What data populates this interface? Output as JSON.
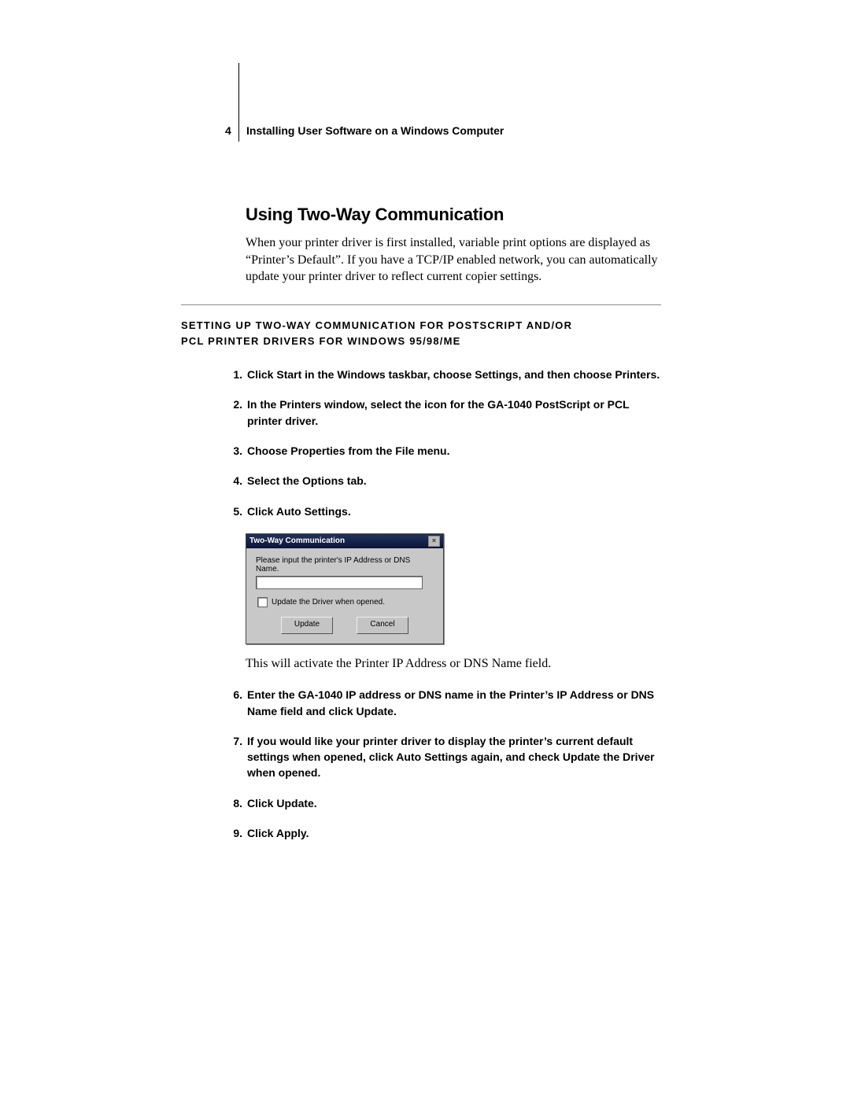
{
  "header": {
    "page_number": "4",
    "running_head": "Installing User Software on a Windows Computer"
  },
  "section": {
    "title": "Using Two-Way Communication",
    "intro": "When your printer driver is first installed, variable print options are displayed as “Printer’s Default”. If you have a TCP/IP enabled network, you can automatically update your printer driver to reflect current copier settings."
  },
  "procedure": {
    "heading_line1": "Setting Up Two-Way Communication for Postscript and/or",
    "heading_line2": "PCL Printer Drivers for Windows 95/98/Me",
    "steps": [
      "Click Start in the Windows taskbar, choose Settings, and then choose Printers.",
      "In the Printers window, select the icon for the GA-1040 PostScript or PCL printer driver.",
      "Choose Properties from the File menu.",
      "Select the Options tab.",
      "Click Auto Settings."
    ],
    "after_dialog_text": "This will activate the Printer IP Address or DNS Name field.",
    "steps2": [
      "Enter the GA-1040 IP address or DNS name in the Printer’s IP Address or DNS Name field and click Update.",
      "If you would like your printer driver to display the printer’s current default settings when opened, click Auto Settings again, and check Update the Driver when opened.",
      "Click Update.",
      "Click Apply."
    ]
  },
  "dialog": {
    "title": "Two-Way Communication",
    "prompt": "Please input the printer's IP Address or DNS Name.",
    "checkbox_label": "Update the Driver when opened.",
    "update_btn": "Update",
    "cancel_btn": "Cancel"
  }
}
